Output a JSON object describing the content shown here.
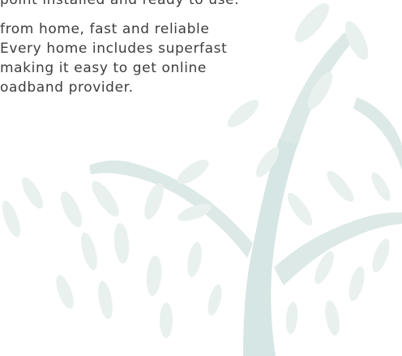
{
  "article": {
    "line_top": "point installed and ready to use.",
    "paragraph_lines": [
      "from home, fast and reliable",
      "Every home includes superfast",
      "making it easy to get online",
      "oadband provider."
    ]
  },
  "decoration": {
    "illustration": "willow-tree-icon",
    "leaf_color": "#e9f1ef",
    "trunk_color": "#d6e6e4",
    "text_color": "#3d3d3d"
  }
}
